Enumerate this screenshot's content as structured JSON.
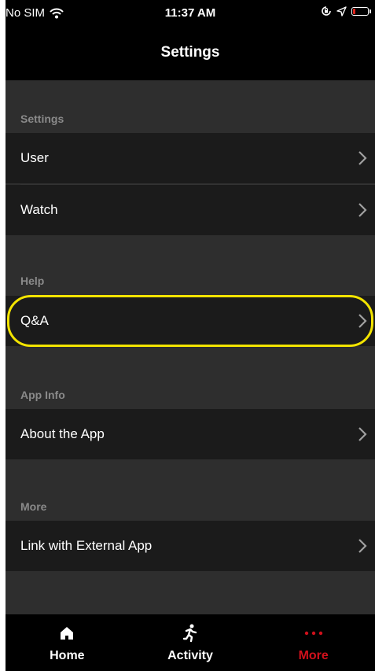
{
  "status_bar": {
    "carrier": "No SIM",
    "time": "11:37 AM",
    "icons": [
      "wifi-icon",
      "orientation-lock-icon",
      "location-icon",
      "battery-low-icon"
    ]
  },
  "nav": {
    "title": "Settings"
  },
  "sections": [
    {
      "header": "Settings",
      "rows": [
        {
          "label": "User"
        },
        {
          "label": "Watch"
        }
      ]
    },
    {
      "header": "Help",
      "rows": [
        {
          "label": "Q&A"
        }
      ]
    },
    {
      "header": "App Info",
      "rows": [
        {
          "label": "About the App"
        }
      ]
    },
    {
      "header": "More",
      "rows": [
        {
          "label": "Link with External App"
        }
      ]
    }
  ],
  "highlight": {
    "color": "#f3e400",
    "target": "Q&A"
  },
  "tabs": [
    {
      "label": "Home",
      "icon": "home-icon",
      "active": false
    },
    {
      "label": "Activity",
      "icon": "running-person-icon",
      "active": false
    },
    {
      "label": "More",
      "icon": "more-dots-icon",
      "active": true
    }
  ],
  "colors": {
    "accent": "#d0101b",
    "background": "#2e2e2e",
    "row": "#1b1b1b",
    "section_header": "#8a8a8a"
  }
}
